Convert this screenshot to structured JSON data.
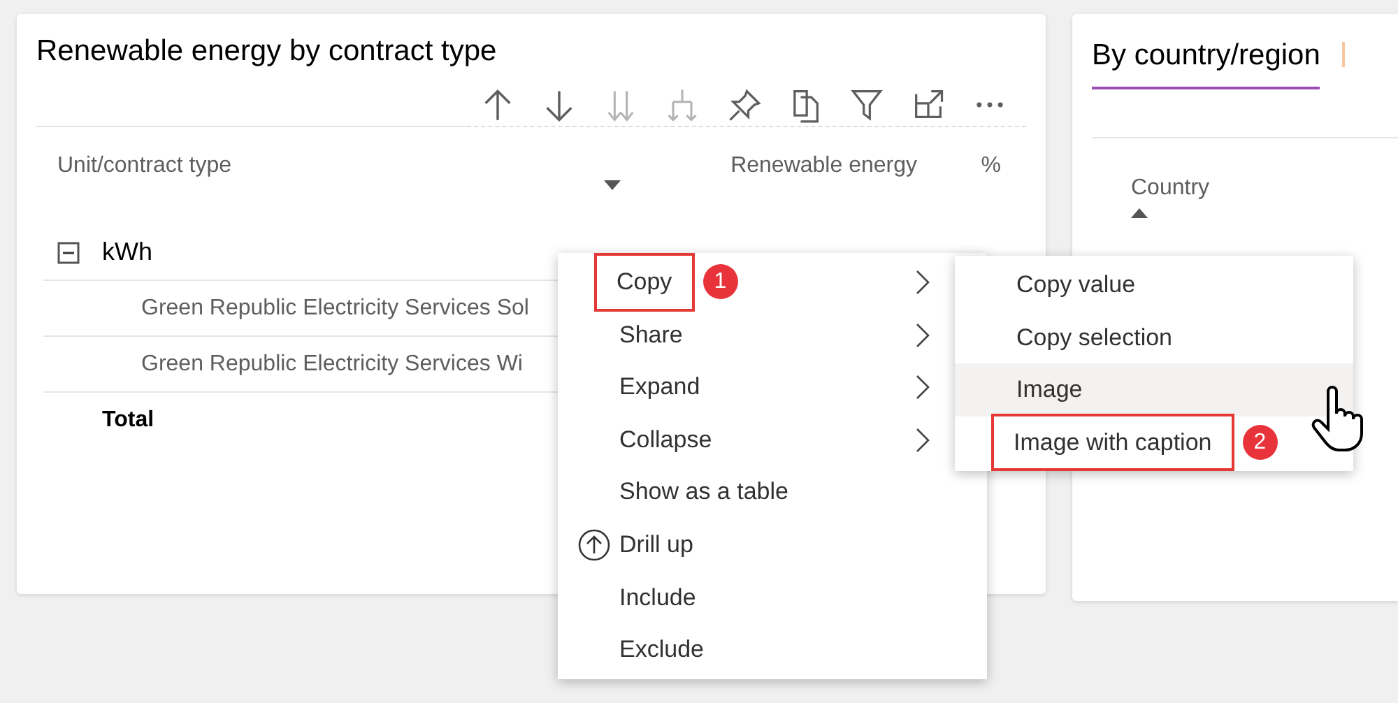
{
  "visual": {
    "title": "Renewable energy by contract type",
    "toolbar": [
      {
        "kind": "up",
        "disabled": false
      },
      {
        "kind": "down",
        "disabled": false
      },
      {
        "kind": "double-down",
        "disabled": true
      },
      {
        "kind": "expand-level",
        "disabled": true
      },
      {
        "kind": "pin",
        "disabled": false
      },
      {
        "kind": "copy",
        "disabled": false
      },
      {
        "kind": "filter",
        "disabled": false
      },
      {
        "kind": "focus",
        "disabled": false
      },
      {
        "kind": "more",
        "disabled": false
      }
    ],
    "columns": [
      {
        "label": "Unit/contract type",
        "sorted": false
      },
      {
        "label": "Renewable energy",
        "sorted": true,
        "descending": true
      },
      {
        "label": "%",
        "sorted": false
      }
    ],
    "rows": [
      {
        "kind": "group",
        "label": "kWh",
        "expanded": true
      },
      {
        "kind": "child",
        "label": "Green Republic Electricity Services Sol"
      },
      {
        "kind": "child",
        "label": "Green Republic Electricity Services Wi"
      },
      {
        "kind": "total",
        "label": "Total"
      }
    ]
  },
  "second_visual": {
    "tabs": [
      {
        "label": "By country/region",
        "selected": true
      }
    ],
    "columns": [
      {
        "label": "Country",
        "sorted": true,
        "descending": false
      }
    ]
  },
  "context_menu": {
    "items": [
      {
        "label": "Copy",
        "submenu": true,
        "kind": "plain",
        "marked": true,
        "step": "1"
      },
      {
        "label": "Share",
        "submenu": true,
        "kind": "plain",
        "marked": false
      },
      {
        "label": "Expand",
        "submenu": true,
        "kind": "plain",
        "marked": false
      },
      {
        "label": "Collapse",
        "submenu": true,
        "kind": "plain",
        "marked": false
      },
      {
        "label": "Show as a table",
        "submenu": false,
        "kind": "plain",
        "marked": false
      },
      {
        "label": "Drill up",
        "submenu": false,
        "kind": "drill-up",
        "marked": false
      },
      {
        "label": "Include",
        "submenu": false,
        "kind": "plain",
        "marked": false
      },
      {
        "label": "Exclude",
        "submenu": false,
        "kind": "plain",
        "marked": false
      }
    ]
  },
  "submenu": {
    "items": [
      {
        "label": "Copy value",
        "hovered": false,
        "marked": false
      },
      {
        "label": "Copy selection",
        "hovered": false,
        "marked": false
      },
      {
        "label": "Image",
        "hovered": true,
        "marked": false
      },
      {
        "label": "Image with caption",
        "hovered": false,
        "marked": true,
        "step": "2"
      }
    ]
  }
}
